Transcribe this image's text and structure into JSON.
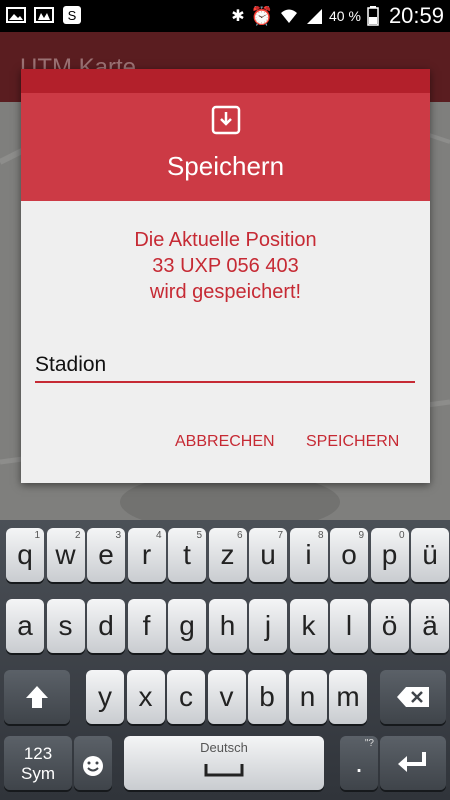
{
  "status_bar": {
    "battery_percent": "40 %",
    "time": "20:59",
    "icons": [
      "image-icon",
      "cloud-upload-icon",
      "sync-icon",
      "bluetooth-icon",
      "alarm-icon",
      "wifi-icon",
      "signal-icon",
      "battery-icon"
    ]
  },
  "app": {
    "title": "UTM Karte"
  },
  "dialog": {
    "icon": "save-download-icon",
    "title": "Speichern",
    "message_lines": [
      "Die Aktuelle Position",
      "33 UXP 056 403",
      "wird gespeichert!"
    ],
    "input_value": "Stadion",
    "cancel_label": "ABBRECHEN",
    "save_label": "SPEICHERN",
    "accent_color": "#c62a34",
    "header_color": "#cc3a45"
  },
  "keyboard": {
    "row1": [
      {
        "k": "q",
        "h": "1"
      },
      {
        "k": "w",
        "h": "2"
      },
      {
        "k": "e",
        "h": "3"
      },
      {
        "k": "r",
        "h": "4"
      },
      {
        "k": "t",
        "h": "5"
      },
      {
        "k": "z",
        "h": "6"
      },
      {
        "k": "u",
        "h": "7"
      },
      {
        "k": "i",
        "h": "8"
      },
      {
        "k": "o",
        "h": "9"
      },
      {
        "k": "p",
        "h": "0"
      },
      {
        "k": "ü",
        "h": ""
      }
    ],
    "row2": [
      "a",
      "s",
      "d",
      "f",
      "g",
      "h",
      "j",
      "k",
      "l",
      "ö",
      "ä"
    ],
    "row3": [
      "y",
      "x",
      "c",
      "v",
      "b",
      "n",
      "m"
    ],
    "sym_label": "123\nSym",
    "space_label": "Deutsch",
    "period_label": ".",
    "period_hint": "\"?"
  }
}
